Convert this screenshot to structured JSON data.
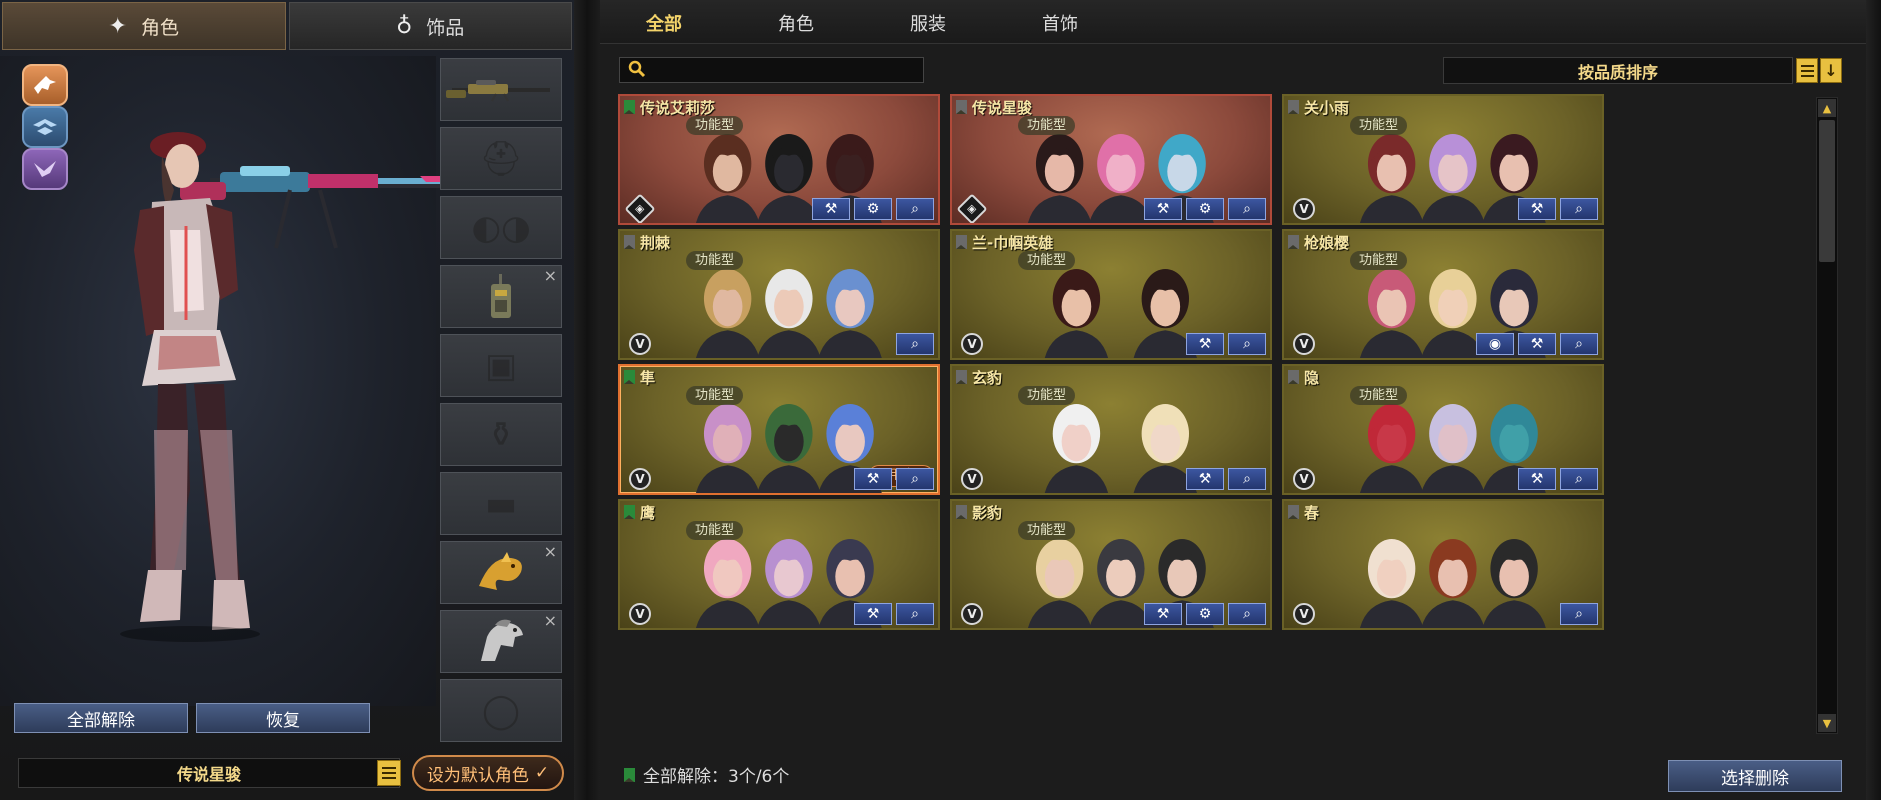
{
  "left_panel": {
    "tabs": [
      {
        "label": "角色",
        "icon": "character-icon",
        "active": true
      },
      {
        "label": "饰品",
        "icon": "ring-icon",
        "active": false
      }
    ],
    "factions": [
      "eagle-faction-icon",
      "wings-faction-icon",
      "bird-faction-icon"
    ],
    "slots": [
      {
        "icon": "sniper-rifle-icon",
        "filled": true,
        "removable": false
      },
      {
        "icon": "helmet-slot-icon",
        "filled": false,
        "removable": false
      },
      {
        "icon": "goggles-slot-icon",
        "filled": false,
        "removable": false
      },
      {
        "icon": "radio-icon",
        "filled": true,
        "removable": true
      },
      {
        "icon": "vest-slot-icon",
        "filled": false,
        "removable": false
      },
      {
        "icon": "bottle-slot-icon",
        "filled": false,
        "removable": false
      },
      {
        "icon": "pants-slot-icon",
        "filled": false,
        "removable": false
      },
      {
        "icon": "golden-dragon-icon",
        "filled": true,
        "removable": true
      },
      {
        "icon": "silver-horse-icon",
        "filled": true,
        "removable": true
      },
      {
        "icon": "ring-slot-icon",
        "filled": false,
        "removable": false
      }
    ],
    "unequip_all_label": "全部解除",
    "restore_label": "恢复",
    "character_name": "传说星骏",
    "set_default_label": "设为默认角色",
    "check_glyph": "✓"
  },
  "right_panel": {
    "category_tabs": [
      {
        "label": "全部",
        "active": true
      },
      {
        "label": "角色",
        "active": false
      },
      {
        "label": "服装",
        "active": false
      },
      {
        "label": "首饰",
        "active": false
      }
    ],
    "search": {
      "value": "",
      "placeholder": ""
    },
    "sort_label": "按品质排序",
    "sort_dir_glyph": "↓",
    "cards": [
      {
        "title": "传说艾莉莎",
        "tag": "功能型",
        "rank": "legend",
        "bookmark": "green",
        "actions": [
          "wrench",
          "gear",
          "search"
        ],
        "heads": [
          "#e0b8a0",
          "#2a2a30",
          "#3a2020"
        ],
        "hair": [
          "#5a2e20",
          "#1a1a1a",
          "#3a1a1a"
        ],
        "theme": "legend"
      },
      {
        "title": "传说星骏",
        "tag": "功能型",
        "rank": "legend",
        "bookmark": "gray",
        "actions": [
          "wrench",
          "gear",
          "search"
        ],
        "heads": [
          "#e6b8a8",
          "#f0b0c8",
          "#c8d8e8"
        ],
        "hair": [
          "#2a1a1a",
          "#e070a8",
          "#40a8c8"
        ],
        "theme": "legend"
      },
      {
        "title": "关小雨",
        "tag": "功能型",
        "rank": "V",
        "bookmark": "gray",
        "actions": [
          "wrench",
          "search"
        ],
        "heads": [
          "#e8c0b0",
          "#e6c4c8",
          "#e8c0b0"
        ],
        "hair": [
          "#7a2a2a",
          "#b890d8",
          "#3a1a20"
        ],
        "theme": "gold"
      },
      {
        "title": "荆棘",
        "tag": "功能型",
        "rank": "V",
        "bookmark": "gray",
        "actions": [
          "search"
        ],
        "heads": [
          "#e0b8a0",
          "#eccab8",
          "#e8c8c0"
        ],
        "hair": [
          "#c8a060",
          "#e8e8e8",
          "#6a90d0"
        ],
        "theme": "gold"
      },
      {
        "title": "兰-巾帼英雄",
        "tag": "功能型",
        "rank": "V",
        "bookmark": "gray",
        "actions": [
          "wrench",
          "search"
        ],
        "heads": [
          "#e8c0a8",
          "#e8c0a8"
        ],
        "hair": [
          "#3a1a18",
          "#2a1a18"
        ],
        "theme": "gold"
      },
      {
        "title": "枪娘樱",
        "tag": "功能型",
        "rank": "V",
        "bookmark": "gray",
        "actions": [
          "disc",
          "wrench",
          "search"
        ],
        "heads": [
          "#eac4b4",
          "#f0d0b8",
          "#e8c8b8"
        ],
        "hair": [
          "#c85a78",
          "#e8d098",
          "#2a2a3a"
        ],
        "theme": "gold"
      },
      {
        "title": "隼",
        "tag": "功能型",
        "rank": "V",
        "bookmark": "green",
        "actions": [
          "wrench",
          "search"
        ],
        "heads": [
          "#e0b0b8",
          "#2a2a2a",
          "#e8c8c0"
        ],
        "hair": [
          "#c890c8",
          "#3a6a3a",
          "#5a80d8"
        ],
        "theme": "gold",
        "selected": true,
        "in_use": "使用中✓"
      },
      {
        "title": "玄豹",
        "tag": "功能型",
        "rank": "V",
        "bookmark": "gray",
        "actions": [
          "wrench",
          "search"
        ],
        "heads": [
          "#f0d0c8",
          "#f0d8c8"
        ],
        "hair": [
          "#f0f0f0",
          "#f0e0b8"
        ],
        "theme": "gold"
      },
      {
        "title": "隐",
        "tag": "功能型",
        "rank": "V",
        "bookmark": "gray",
        "actions": [
          "wrench",
          "search"
        ],
        "heads": [
          "#c83848",
          "#e0c0c8",
          "#40a0a8"
        ],
        "hair": [
          "#c02838",
          "#c8c0e0",
          "#308898"
        ],
        "theme": "gold"
      },
      {
        "title": "鹰",
        "tag": "功能型",
        "rank": "V",
        "bookmark": "green",
        "actions": [
          "wrench",
          "search"
        ],
        "heads": [
          "#f0c8c0",
          "#e8c8d0",
          "#e8c0b0"
        ],
        "hair": [
          "#f0a8c0",
          "#b890d0",
          "#3a3a50"
        ],
        "theme": "gold"
      },
      {
        "title": "影豹",
        "tag": "功能型",
        "rank": "V",
        "bookmark": "gray",
        "actions": [
          "wrench",
          "gear",
          "search"
        ],
        "heads": [
          "#eac8b8",
          "#ecccbc",
          "#e8c8b8"
        ],
        "hair": [
          "#e8d0a0",
          "#3a3a40",
          "#2a2a2a"
        ],
        "theme": "gold"
      },
      {
        "title": "春",
        "tag": "",
        "rank": "V",
        "bookmark": "gray",
        "actions": [
          "search"
        ],
        "heads": [
          "#f0d0c0",
          "#e8c0b0",
          "#e8c0b0"
        ],
        "hair": [
          "#f0e0d0",
          "#8a3a20",
          "#2a2a2a"
        ],
        "theme": "gold"
      }
    ],
    "footer_text": "全部解除：3个/6个",
    "delete_select_label": "选择删除",
    "scroll_up_glyph": "▲",
    "scroll_down_glyph": "▼"
  }
}
